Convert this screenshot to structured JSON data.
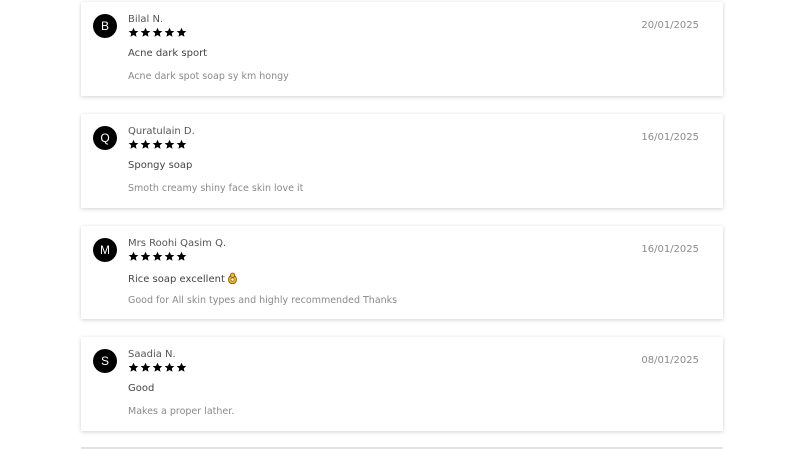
{
  "reviews": [
    {
      "initial": "B",
      "name": "Bilal N.",
      "rating": 5,
      "date": "20/01/2025",
      "title": "Acne dark sport",
      "body": "Acne dark spot soap sy km hongy",
      "emoji": ""
    },
    {
      "initial": "Q",
      "name": "Quratulain D.",
      "rating": 5,
      "date": "16/01/2025",
      "title": "Spongy soap",
      "body": "Smoth creamy shiny face skin love it",
      "emoji": ""
    },
    {
      "initial": "M",
      "name": "Mrs Roohi Qasim Q.",
      "rating": 5,
      "date": "16/01/2025",
      "title": "Rice soap excellent",
      "body": "Good for All skin types and highly recommended Thanks",
      "emoji": "ok-hand-icon"
    },
    {
      "initial": "S",
      "name": "Saadia N.",
      "rating": 5,
      "date": "08/01/2025",
      "title": "Good",
      "body": "Makes a proper lather.",
      "emoji": ""
    }
  ],
  "colors": {
    "avatar_bg": "#000000",
    "star": "#000000",
    "card_bg": "#ffffff"
  }
}
